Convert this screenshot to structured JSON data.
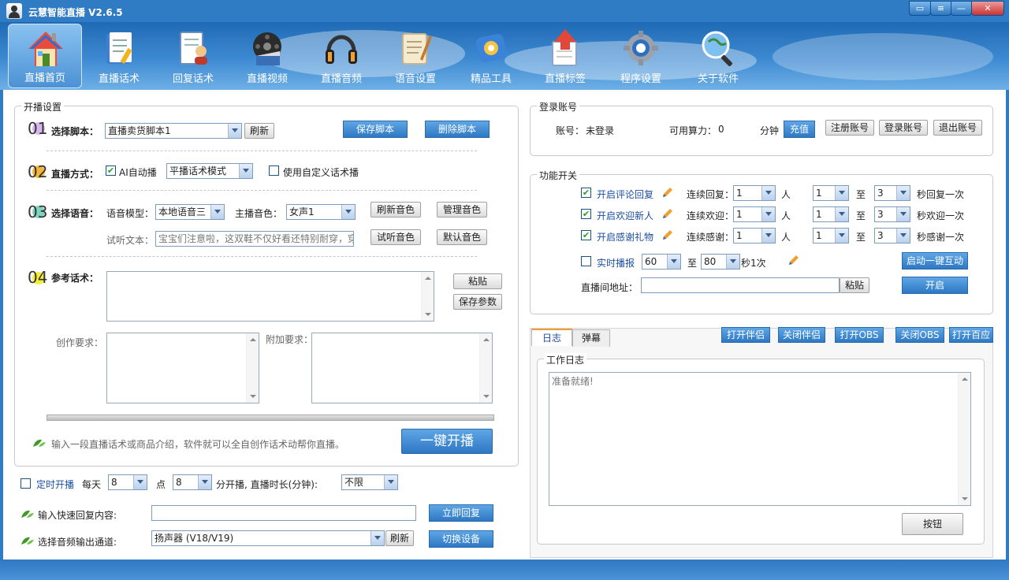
{
  "app": {
    "title": "云慧智能直播 V2.6.5"
  },
  "window_controls": {
    "chat": "▭",
    "menu": "≡",
    "minimize": "—",
    "close": "✕"
  },
  "toolbar": {
    "items": [
      {
        "label": "直播首页",
        "icon": "home-icon"
      },
      {
        "label": "直播话术",
        "icon": "script-icon"
      },
      {
        "label": "回复话术",
        "icon": "reply-icon"
      },
      {
        "label": "直播视频",
        "icon": "video-icon"
      },
      {
        "label": "直播音频",
        "icon": "headphones-icon"
      },
      {
        "label": "语音设置",
        "icon": "scroll-pen-icon"
      },
      {
        "label": "精品工具",
        "icon": "tools-icon"
      },
      {
        "label": "直播标签",
        "icon": "upload-icon"
      },
      {
        "label": "程序设置",
        "icon": "gear-icon"
      },
      {
        "label": "关于软件",
        "icon": "search-globe-icon"
      }
    ]
  },
  "broadcast": {
    "title": "开播设置",
    "step1": {
      "num": "01",
      "label": "选择脚本：",
      "script_value": "直播卖货脚本1",
      "refresh": "刷新",
      "save": "保存脚本",
      "delete": "删除脚本"
    },
    "step2": {
      "num": "02",
      "label": "直播方式：",
      "ai_auto": "AI自动播",
      "mode_value": "平播话术模式",
      "custom": "使用自定义话术播"
    },
    "step3": {
      "num": "03",
      "label": "选择语音：",
      "model_label": "语音模型：",
      "model_value": "本地语音三",
      "voice_label": "主播音色：",
      "voice_value": "女声1",
      "refresh_voice": "刷新音色",
      "manage_voice": "管理音色",
      "test_label": "试听文本：",
      "test_text": "宝宝们注意啦，这双鞋不仅好看还特别耐穿，穿",
      "listen": "试听音色",
      "default_voice": "默认音色"
    },
    "step4": {
      "num": "04",
      "label": "参考话术：",
      "paste": "粘贴",
      "save_params": "保存参数",
      "create_label": "创作要求：",
      "extra_label": "附加要求："
    },
    "tip": "输入一段直播话术或商品介绍，软件就可以全自创作话术动帮你直播。",
    "start": "一键开播"
  },
  "schedule": {
    "label": "定时开播",
    "daily": "每天",
    "hour_value": "8",
    "point": "点",
    "minute_value": "8",
    "minute_label": "分开播, 直播时长(分钟):",
    "duration_value": "不限"
  },
  "quick_reply": {
    "label": "输入快速回复内容:",
    "value": "",
    "button": "立即回复"
  },
  "audio_out": {
    "label": "选择音频输出通道:",
    "value": "扬声器 (V18/V19)",
    "refresh": "刷新",
    "switch": "切换设备"
  },
  "login": {
    "title": "登录账号",
    "account_label": "账号：",
    "account_value": "未登录",
    "power_label": "可用算力：",
    "power_value": "0",
    "minutes": "分钟",
    "recharge": "充值",
    "register": "注册账号",
    "login": "登录账号",
    "logout": "退出账号"
  },
  "functions": {
    "title": "功能开关",
    "rows": [
      {
        "name": "开启评论回复",
        "cont": "连续回复：",
        "n": "1",
        "unit": "人",
        "from": "1",
        "to_label": "至",
        "to": "3",
        "tail": "秒回复一次"
      },
      {
        "name": "开启欢迎新人",
        "cont": "连续欢迎：",
        "n": "1",
        "unit": "人",
        "from": "1",
        "to_label": "至",
        "to": "3",
        "tail": "秒欢迎一次"
      },
      {
        "name": "开启感谢礼物",
        "cont": "连续感谢：",
        "n": "1",
        "unit": "人",
        "from": "1",
        "to_label": "至",
        "to": "3",
        "tail": "秒感谢一次"
      }
    ],
    "realtime": {
      "name": "实时播报",
      "from": "60",
      "to_label": "至",
      "to": "80",
      "unit": "秒1次",
      "button": "启动一键互动"
    },
    "room": {
      "label": "直播间地址：",
      "value": "",
      "paste": "粘贴",
      "open": "开启"
    }
  },
  "log": {
    "tabs": [
      "日志",
      "弹幕"
    ],
    "buttons": [
      "打开伴侣",
      "关闭伴侣",
      "打开OBS",
      "关闭OBS",
      "打开百应"
    ],
    "group_title": "工作日志",
    "content": "准备就绪!",
    "button": "按钮"
  }
}
